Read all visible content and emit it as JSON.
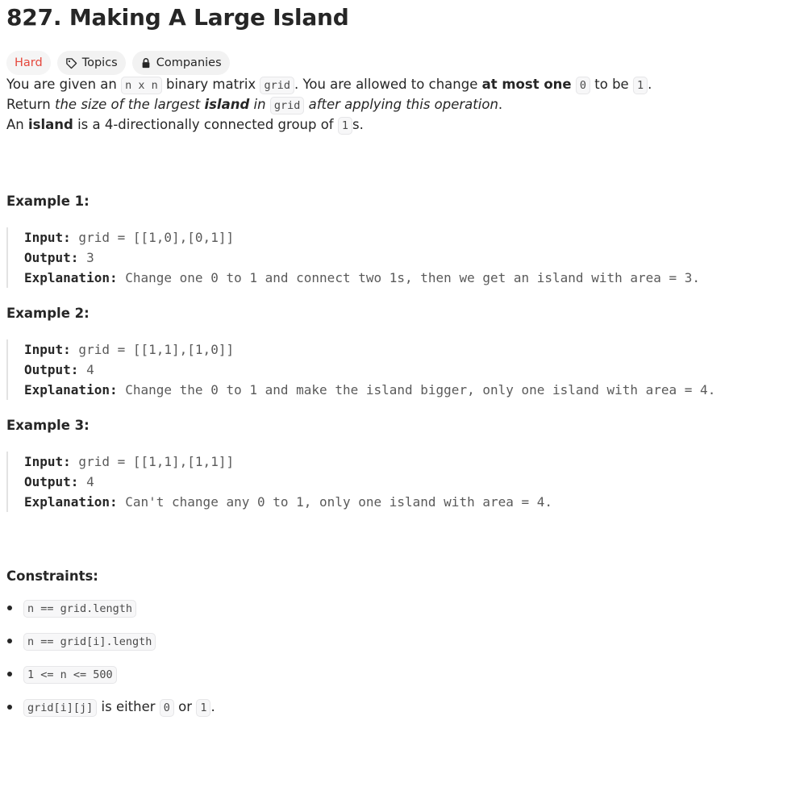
{
  "problem": {
    "title": "827. Making A Large Island",
    "difficulty": "Hard",
    "topics_label": "Topics",
    "companies_label": "Companies"
  },
  "description": {
    "p1": {
      "t1": "You are given an ",
      "c1": "n x n",
      "t2": " binary matrix ",
      "c2": "grid",
      "t3": ". You are allowed to change ",
      "b1": "at most one",
      "t4": " ",
      "c3": "0",
      "t5": " to be ",
      "c4": "1",
      "t6": "."
    },
    "p2": {
      "t1": "Return ",
      "i1": "the size of the largest ",
      "bi1": "island",
      "i2": " in ",
      "c1": "grid",
      "i3": " after applying this operation",
      "t2": "."
    },
    "p3": {
      "t1": "An ",
      "b1": "island",
      "t2": " is a 4-directionally connected group of ",
      "c1": "1",
      "t3": "s."
    }
  },
  "examples": [
    {
      "title": "Example 1:",
      "input_label": "Input:",
      "input_value": " grid = [[1,0],[0,1]]",
      "output_label": "Output:",
      "output_value": " 3",
      "explanation_label": "Explanation:",
      "explanation_value": " Change one 0 to 1 and connect two 1s, then we get an island with area = 3."
    },
    {
      "title": "Example 2:",
      "input_label": "Input:",
      "input_value": " grid = [[1,1],[1,0]]",
      "output_label": "Output:",
      "output_value": " 4",
      "explanation_label": "Explanation:",
      "explanation_value": " Change the 0 to 1 and make the island bigger, only one island with area = 4."
    },
    {
      "title": "Example 3:",
      "input_label": "Input:",
      "input_value": " grid = [[1,1],[1,1]]",
      "output_label": "Output:",
      "output_value": " 4",
      "explanation_label": "Explanation:",
      "explanation_value": " Can't change any 0 to 1, only one island with area = 4."
    }
  ],
  "constraints": {
    "title": "Constraints:",
    "items": [
      {
        "code": "n == grid.length"
      },
      {
        "code": "n == grid[i].length"
      },
      {
        "code": "1 <= n <= 500"
      },
      {
        "code": "grid[i][j]",
        "t1": " is either ",
        "c2": "0",
        "t2": " or ",
        "c3": "1",
        "t3": "."
      }
    ]
  },
  "icons": {
    "tag": "tag-icon",
    "lock": "lock-icon"
  },
  "colors": {
    "hard": "#e5483d",
    "badge_bg": "#f2f2f2",
    "text": "#262626"
  }
}
